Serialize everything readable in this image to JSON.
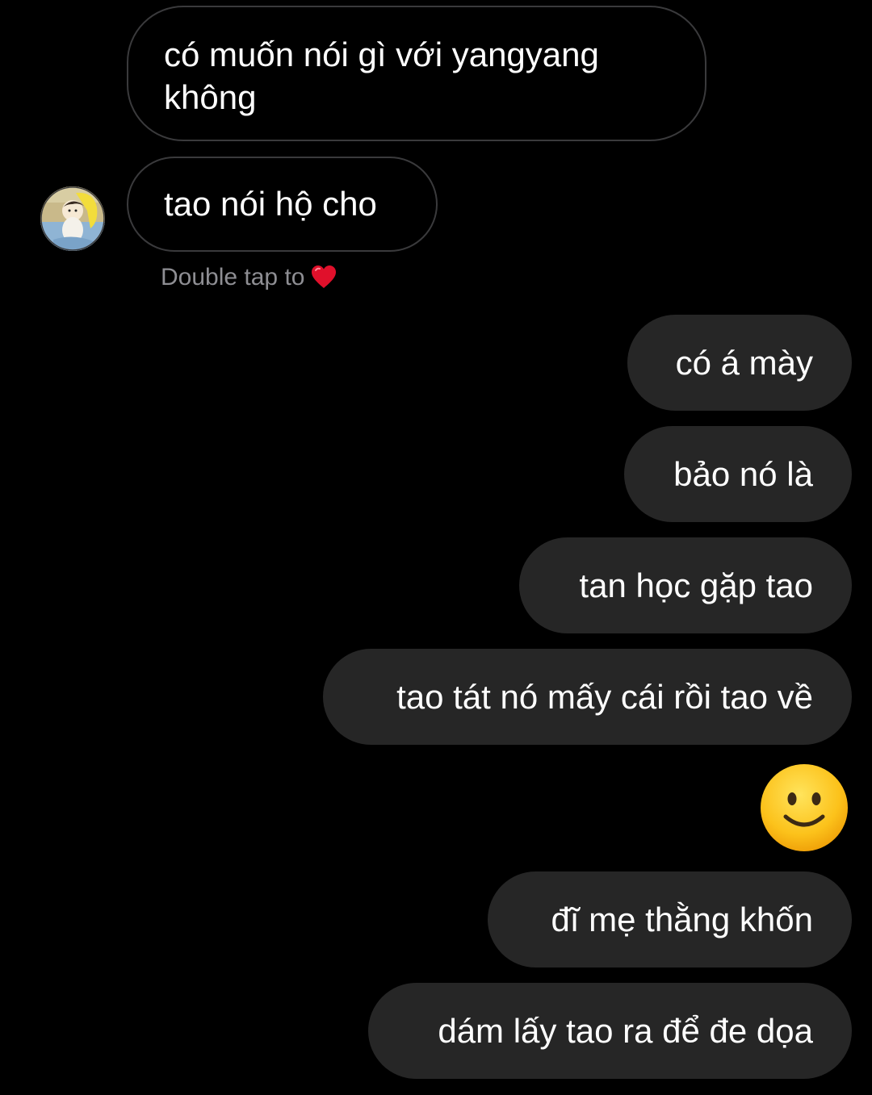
{
  "messages": {
    "incoming": [
      {
        "text": "có muốn nói gì với yangyang không"
      },
      {
        "text": "tao nói hộ cho"
      }
    ],
    "reaction_hint": "Double tap to",
    "reaction_hint_icon": "heart-icon",
    "outgoing": [
      {
        "text": "có á mày"
      },
      {
        "text": "bảo nó là"
      },
      {
        "text": "tan học gặp tao"
      },
      {
        "text": "tao tát nó mấy cái rồi tao về"
      },
      {
        "emoji": "slightly-smiling-face"
      },
      {
        "text": "đĩ mẹ thằng khốn"
      },
      {
        "text": "dám lấy tao ra để đe dọa"
      }
    ]
  },
  "colors": {
    "background": "#000000",
    "outgoing_bubble": "#262626",
    "incoming_border": "#3a3a3c",
    "hint_text": "#8e8e93",
    "heart": "#e0102b"
  }
}
